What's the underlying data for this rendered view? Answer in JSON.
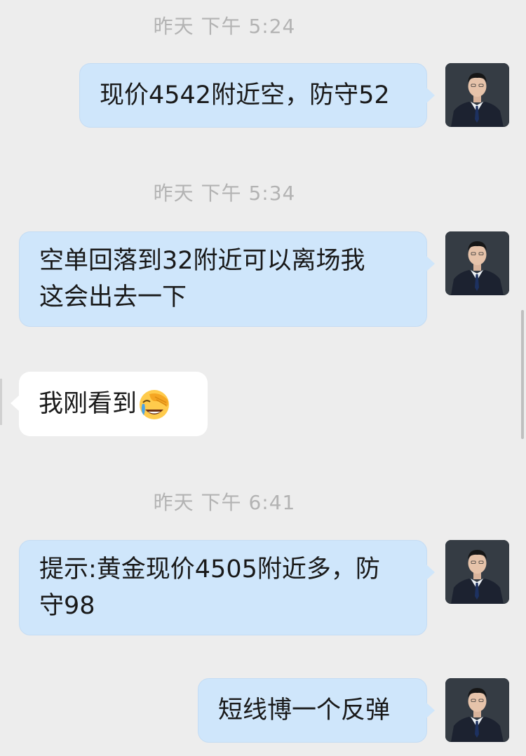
{
  "chat": {
    "messages": [
      {
        "type": "timestamp",
        "text": "昨天  下午 5:24"
      },
      {
        "type": "outgoing",
        "text": "现价4542附近空，防守52"
      },
      {
        "type": "timestamp",
        "text": "昨天  下午 5:34"
      },
      {
        "type": "outgoing",
        "line1": "空单回落到32附近可以离场我",
        "line2": "这会出去一下"
      },
      {
        "type": "incoming",
        "text": "我刚看到",
        "emoji": "facepalm-crying-emoji"
      },
      {
        "type": "timestamp",
        "text": "昨天  下午 6:41"
      },
      {
        "type": "outgoing",
        "line1": "提示:黄金现价4505附近多，防",
        "line2": "守98"
      },
      {
        "type": "outgoing",
        "text": "短线博一个反弹"
      }
    ]
  },
  "icons": {
    "avatar": "user-avatar-icon",
    "emoji": "facepalm-crying-emoji"
  },
  "colors": {
    "background": "#ededed",
    "outgoing_bubble": "#cfe6fb",
    "incoming_bubble": "#ffffff",
    "timestamp_text": "#b3b3b3",
    "message_text": "#191919"
  }
}
